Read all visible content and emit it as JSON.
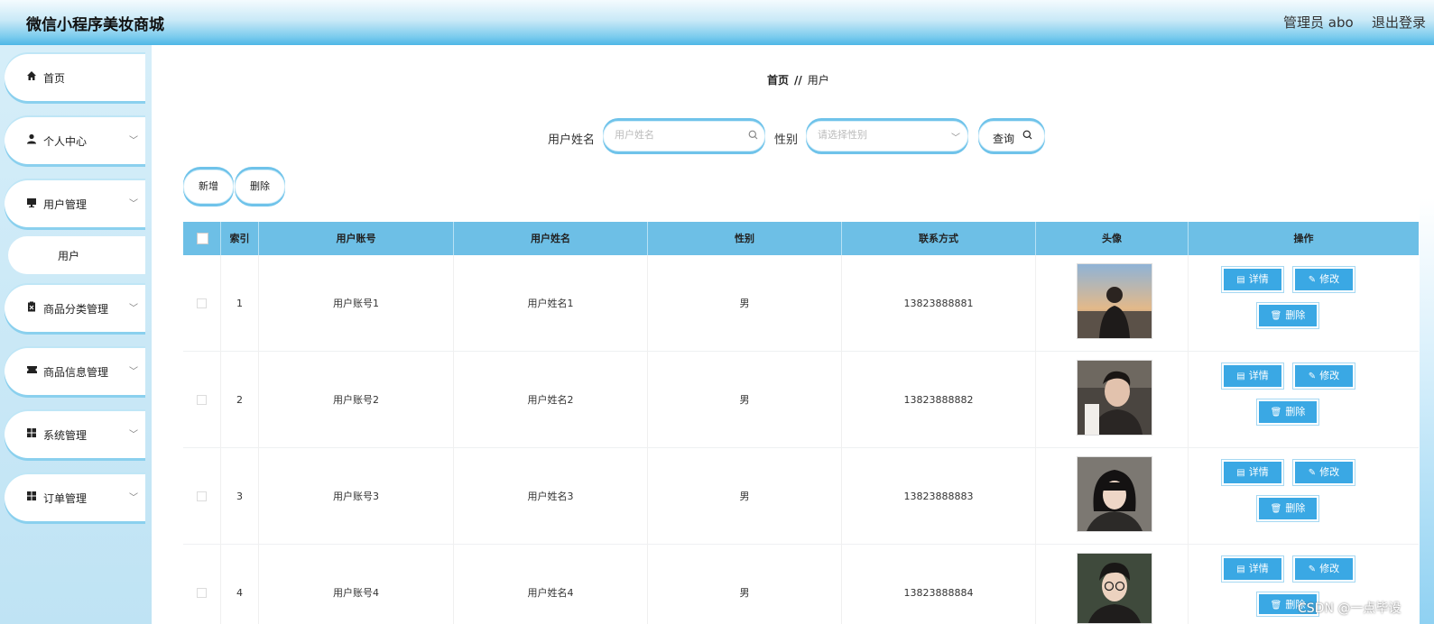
{
  "header": {
    "title": "微信小程序美妆商城",
    "admin": "管理员 abo",
    "logout": "退出登录"
  },
  "sidebar": {
    "items": [
      {
        "label": "首页",
        "icon": "home-icon",
        "glyph": "⌂",
        "has_children": false
      },
      {
        "label": "个人中心",
        "icon": "person-icon",
        "glyph": "👤",
        "has_children": true
      },
      {
        "label": "用户管理",
        "icon": "monitor-icon",
        "glyph": "▬",
        "has_children": true
      },
      {
        "label": "商品分类管理",
        "icon": "clipboard-icon",
        "glyph": "▣",
        "has_children": true
      },
      {
        "label": "商品信息管理",
        "icon": "ticket-icon",
        "glyph": "✖",
        "has_children": true
      },
      {
        "label": "系统管理",
        "icon": "grid-icon",
        "glyph": "▦",
        "has_children": true
      },
      {
        "label": "订单管理",
        "icon": "grid-icon",
        "glyph": "▦",
        "has_children": true
      }
    ],
    "sub_item": "用户",
    "chevron": "﹀"
  },
  "breadcrumb": {
    "home": "首页",
    "sep": "//",
    "current": "用户"
  },
  "search": {
    "name_label": "用户姓名",
    "name_placeholder": "用户姓名",
    "gender_label": "性别",
    "gender_placeholder": "请选择性别",
    "query_label": "查询",
    "search_glyph": "○",
    "select_glyph": "﹀"
  },
  "actions": {
    "add": "新增",
    "delete": "删除"
  },
  "table": {
    "headers": [
      "索引",
      "用户账号",
      "用户姓名",
      "性别",
      "联系方式",
      "头像",
      "操作"
    ],
    "rows": [
      {
        "index": "1",
        "account": "用户账号1",
        "name": "用户姓名1",
        "gender": "男",
        "phone": "13823888881"
      },
      {
        "index": "2",
        "account": "用户账号2",
        "name": "用户姓名2",
        "gender": "男",
        "phone": "13823888882"
      },
      {
        "index": "3",
        "account": "用户账号3",
        "name": "用户姓名3",
        "gender": "男",
        "phone": "13823888883"
      },
      {
        "index": "4",
        "account": "用户账号4",
        "name": "用户姓名4",
        "gender": "男",
        "phone": "13823888884"
      }
    ],
    "ops": {
      "detail": "详情",
      "edit": "修改",
      "delete": "删除"
    }
  },
  "watermark": "CSDN @一点毕设",
  "colors": {
    "accent": "#6dbfe6",
    "button": "#3aa8e4"
  }
}
